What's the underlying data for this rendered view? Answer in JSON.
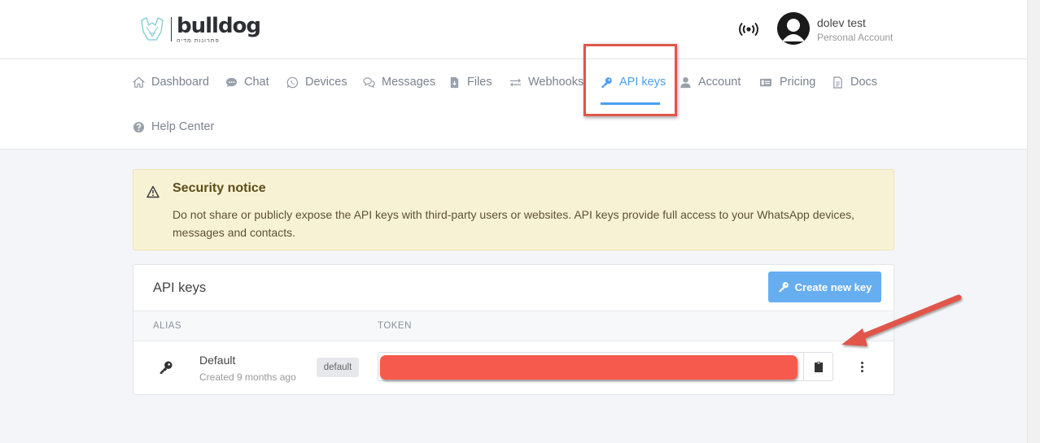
{
  "header": {
    "logo_word": "bulldog",
    "logo_tagline": "פתרונות מדיה",
    "user_name": "dolev test",
    "user_subtitle": "Personal Account",
    "status_icon": "broadcast-icon"
  },
  "nav": {
    "items": [
      {
        "label": "Dashboard",
        "icon": "home-icon"
      },
      {
        "label": "Chat",
        "icon": "chat-bubble-icon"
      },
      {
        "label": "Devices",
        "icon": "whatsapp-icon"
      },
      {
        "label": "Messages",
        "icon": "messages-icon"
      },
      {
        "label": "Files",
        "icon": "file-icon"
      },
      {
        "label": "Webhooks",
        "icon": "exchange-arrows-icon"
      },
      {
        "label": "API keys",
        "icon": "key-icon",
        "active": true
      },
      {
        "label": "Account",
        "icon": "user-icon"
      },
      {
        "label": "Pricing",
        "icon": "money-bill-icon"
      },
      {
        "label": "Docs",
        "icon": "document-icon"
      },
      {
        "label": "Help Center",
        "icon": "question-circle-icon"
      }
    ],
    "active_color": "#4a9ff0"
  },
  "notice": {
    "title": "Security notice",
    "body": "Do not share or publicly expose the API keys with third-party users or websites. API keys provide full access to your WhatsApp devices, messages and contacts.",
    "icon": "warning-triangle-icon"
  },
  "api_keys": {
    "title": "API keys",
    "create_button": "Create new key",
    "columns": [
      "ALIAS",
      "TOKEN"
    ],
    "rows": [
      {
        "alias": "Default",
        "created": "Created 9 months ago",
        "badge": "default",
        "token": ""
      }
    ]
  },
  "annotations": {
    "highlight_color": "#e0564c",
    "redaction_color": "#f65a4c"
  }
}
